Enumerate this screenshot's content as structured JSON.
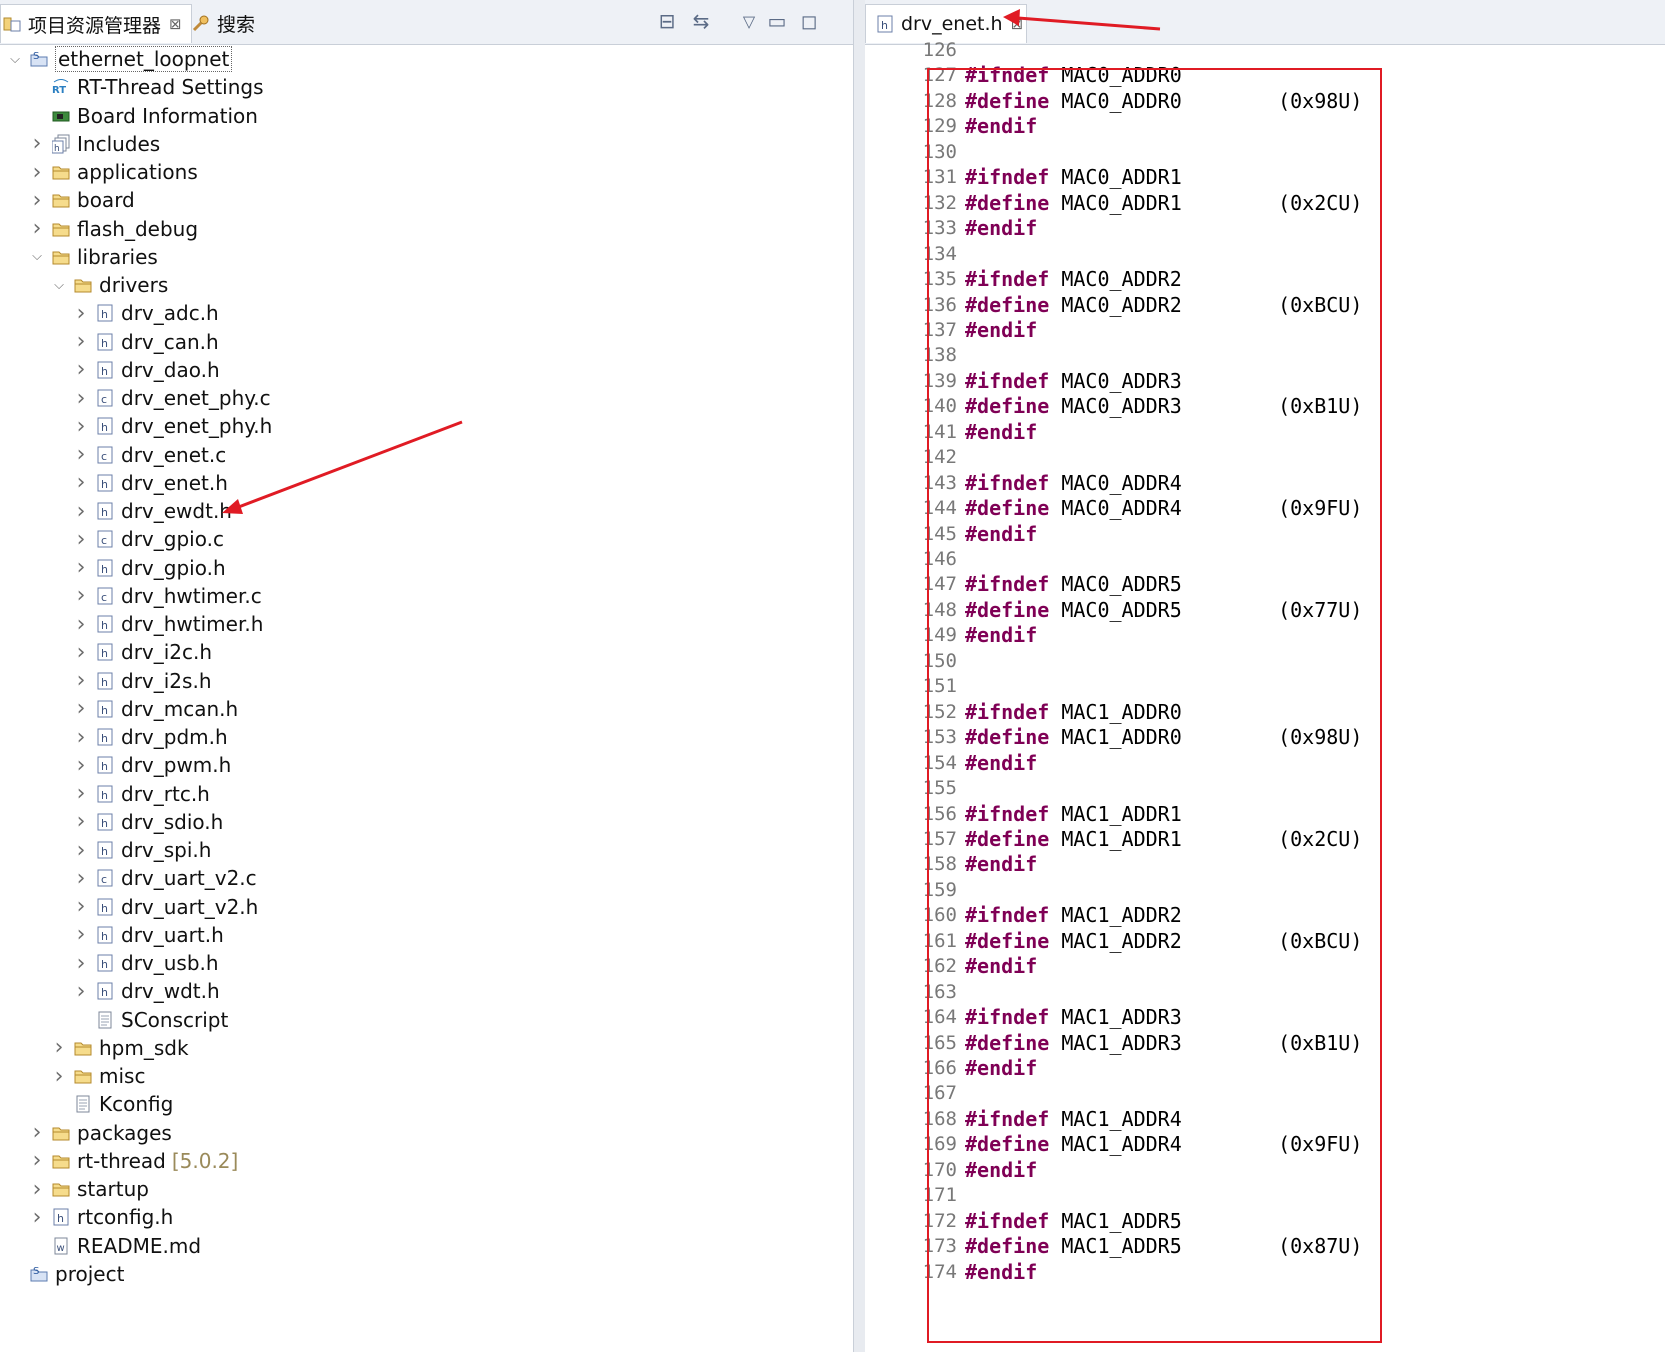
{
  "left_panel": {
    "tabs": [
      {
        "label": "项目资源管理器",
        "close": "⊠",
        "icon": "project-explorer-icon"
      },
      {
        "label": "搜索",
        "icon": "search-icon"
      }
    ],
    "toolbar": [
      "collapse-all-icon",
      "link-with-editor-icon",
      "view-menu-icon",
      "minimize-icon",
      "maximize-icon"
    ],
    "tree": [
      {
        "label": "ethernet_loopnet",
        "depth": 0,
        "expand": "open",
        "icon": "project-icon",
        "selected": true
      },
      {
        "label": "RT-Thread Settings",
        "depth": 1,
        "expand": "none",
        "icon": "rt-settings-icon"
      },
      {
        "label": "Board Information",
        "depth": 1,
        "expand": "none",
        "icon": "board-icon"
      },
      {
        "label": "Includes",
        "depth": 1,
        "expand": "closed",
        "icon": "includes-icon"
      },
      {
        "label": "applications",
        "depth": 1,
        "expand": "closed",
        "icon": "folder-icon"
      },
      {
        "label": "board",
        "depth": 1,
        "expand": "closed",
        "icon": "folder-icon"
      },
      {
        "label": "flash_debug",
        "depth": 1,
        "expand": "closed",
        "icon": "folder-icon"
      },
      {
        "label": "libraries",
        "depth": 1,
        "expand": "open",
        "icon": "folder-icon"
      },
      {
        "label": "drivers",
        "depth": 2,
        "expand": "open",
        "icon": "folder-icon"
      },
      {
        "label": "drv_adc.h",
        "depth": 3,
        "expand": "closed",
        "icon": "h-file-icon"
      },
      {
        "label": "drv_can.h",
        "depth": 3,
        "expand": "closed",
        "icon": "h-file-icon"
      },
      {
        "label": "drv_dao.h",
        "depth": 3,
        "expand": "closed",
        "icon": "h-file-icon"
      },
      {
        "label": "drv_enet_phy.c",
        "depth": 3,
        "expand": "closed",
        "icon": "c-file-icon"
      },
      {
        "label": "drv_enet_phy.h",
        "depth": 3,
        "expand": "closed",
        "icon": "h-file-icon"
      },
      {
        "label": "drv_enet.c",
        "depth": 3,
        "expand": "closed",
        "icon": "c-file-icon"
      },
      {
        "label": "drv_enet.h",
        "depth": 3,
        "expand": "closed",
        "icon": "h-file-icon"
      },
      {
        "label": "drv_ewdt.h",
        "depth": 3,
        "expand": "closed",
        "icon": "h-file-icon"
      },
      {
        "label": "drv_gpio.c",
        "depth": 3,
        "expand": "closed",
        "icon": "c-file-icon"
      },
      {
        "label": "drv_gpio.h",
        "depth": 3,
        "expand": "closed",
        "icon": "h-file-icon"
      },
      {
        "label": "drv_hwtimer.c",
        "depth": 3,
        "expand": "closed",
        "icon": "c-file-icon"
      },
      {
        "label": "drv_hwtimer.h",
        "depth": 3,
        "expand": "closed",
        "icon": "h-file-icon"
      },
      {
        "label": "drv_i2c.h",
        "depth": 3,
        "expand": "closed",
        "icon": "h-file-icon"
      },
      {
        "label": "drv_i2s.h",
        "depth": 3,
        "expand": "closed",
        "icon": "h-file-icon"
      },
      {
        "label": "drv_mcan.h",
        "depth": 3,
        "expand": "closed",
        "icon": "h-file-icon"
      },
      {
        "label": "drv_pdm.h",
        "depth": 3,
        "expand": "closed",
        "icon": "h-file-icon"
      },
      {
        "label": "drv_pwm.h",
        "depth": 3,
        "expand": "closed",
        "icon": "h-file-icon"
      },
      {
        "label": "drv_rtc.h",
        "depth": 3,
        "expand": "closed",
        "icon": "h-file-icon"
      },
      {
        "label": "drv_sdio.h",
        "depth": 3,
        "expand": "closed",
        "icon": "h-file-icon"
      },
      {
        "label": "drv_spi.h",
        "depth": 3,
        "expand": "closed",
        "icon": "h-file-icon"
      },
      {
        "label": "drv_uart_v2.c",
        "depth": 3,
        "expand": "closed",
        "icon": "c-file-icon"
      },
      {
        "label": "drv_uart_v2.h",
        "depth": 3,
        "expand": "closed",
        "icon": "h-file-icon"
      },
      {
        "label": "drv_uart.h",
        "depth": 3,
        "expand": "closed",
        "icon": "h-file-icon"
      },
      {
        "label": "drv_usb.h",
        "depth": 3,
        "expand": "closed",
        "icon": "h-file-icon"
      },
      {
        "label": "drv_wdt.h",
        "depth": 3,
        "expand": "closed",
        "icon": "h-file-icon"
      },
      {
        "label": "SConscript",
        "depth": 3,
        "expand": "none",
        "icon": "text-file-icon"
      },
      {
        "label": "hpm_sdk",
        "depth": 2,
        "expand": "closed",
        "icon": "folder-icon"
      },
      {
        "label": "misc",
        "depth": 2,
        "expand": "closed",
        "icon": "folder-icon"
      },
      {
        "label": "Kconfig",
        "depth": 2,
        "expand": "none",
        "icon": "text-file-icon"
      },
      {
        "label": "packages",
        "depth": 1,
        "expand": "closed",
        "icon": "folder-icon"
      },
      {
        "label": "rt-thread",
        "depth": 1,
        "expand": "closed",
        "icon": "folder-icon",
        "suffix": "[5.0.2]"
      },
      {
        "label": "startup",
        "depth": 1,
        "expand": "closed",
        "icon": "folder-icon"
      },
      {
        "label": "rtconfig.h",
        "depth": 1,
        "expand": "closed",
        "icon": "h-file-icon"
      },
      {
        "label": "README.md",
        "depth": 1,
        "expand": "none",
        "icon": "md-file-icon"
      },
      {
        "label": "project",
        "depth": 0,
        "expand": "none",
        "icon": "project-icon"
      }
    ]
  },
  "editor": {
    "tab": {
      "label": "drv_enet.h",
      "close": "⊠",
      "icon": "h-file-icon"
    },
    "lines": [
      {
        "num": "126",
        "kw": "",
        "text": ""
      },
      {
        "num": "127",
        "kw": "#ifndef",
        "text": " MAC0_ADDR0"
      },
      {
        "num": "128",
        "kw": "#define",
        "text": " MAC0_ADDR0        (0x98U)"
      },
      {
        "num": "129",
        "kw": "#endif",
        "text": ""
      },
      {
        "num": "130",
        "kw": "",
        "text": ""
      },
      {
        "num": "131",
        "kw": "#ifndef",
        "text": " MAC0_ADDR1"
      },
      {
        "num": "132",
        "kw": "#define",
        "text": " MAC0_ADDR1        (0x2CU)"
      },
      {
        "num": "133",
        "kw": "#endif",
        "text": ""
      },
      {
        "num": "134",
        "kw": "",
        "text": ""
      },
      {
        "num": "135",
        "kw": "#ifndef",
        "text": " MAC0_ADDR2"
      },
      {
        "num": "136",
        "kw": "#define",
        "text": " MAC0_ADDR2        (0xBCU)"
      },
      {
        "num": "137",
        "kw": "#endif",
        "text": ""
      },
      {
        "num": "138",
        "kw": "",
        "text": ""
      },
      {
        "num": "139",
        "kw": "#ifndef",
        "text": " MAC0_ADDR3"
      },
      {
        "num": "140",
        "kw": "#define",
        "text": " MAC0_ADDR3        (0xB1U)"
      },
      {
        "num": "141",
        "kw": "#endif",
        "text": ""
      },
      {
        "num": "142",
        "kw": "",
        "text": ""
      },
      {
        "num": "143",
        "kw": "#ifndef",
        "text": " MAC0_ADDR4"
      },
      {
        "num": "144",
        "kw": "#define",
        "text": " MAC0_ADDR4        (0x9FU)"
      },
      {
        "num": "145",
        "kw": "#endif",
        "text": ""
      },
      {
        "num": "146",
        "kw": "",
        "text": ""
      },
      {
        "num": "147",
        "kw": "#ifndef",
        "text": " MAC0_ADDR5"
      },
      {
        "num": "148",
        "kw": "#define",
        "text": " MAC0_ADDR5        (0x77U)"
      },
      {
        "num": "149",
        "kw": "#endif",
        "text": ""
      },
      {
        "num": "150",
        "kw": "",
        "text": ""
      },
      {
        "num": "151",
        "kw": "",
        "text": ""
      },
      {
        "num": "152",
        "kw": "#ifndef",
        "text": " MAC1_ADDR0"
      },
      {
        "num": "153",
        "kw": "#define",
        "text": " MAC1_ADDR0        (0x98U)"
      },
      {
        "num": "154",
        "kw": "#endif",
        "text": ""
      },
      {
        "num": "155",
        "kw": "",
        "text": ""
      },
      {
        "num": "156",
        "kw": "#ifndef",
        "text": " MAC1_ADDR1"
      },
      {
        "num": "157",
        "kw": "#define",
        "text": " MAC1_ADDR1        (0x2CU)"
      },
      {
        "num": "158",
        "kw": "#endif",
        "text": ""
      },
      {
        "num": "159",
        "kw": "",
        "text": ""
      },
      {
        "num": "160",
        "kw": "#ifndef",
        "text": " MAC1_ADDR2"
      },
      {
        "num": "161",
        "kw": "#define",
        "text": " MAC1_ADDR2        (0xBCU)"
      },
      {
        "num": "162",
        "kw": "#endif",
        "text": ""
      },
      {
        "num": "163",
        "kw": "",
        "text": ""
      },
      {
        "num": "164",
        "kw": "#ifndef",
        "text": " MAC1_ADDR3"
      },
      {
        "num": "165",
        "kw": "#define",
        "text": " MAC1_ADDR3        (0xB1U)"
      },
      {
        "num": "166",
        "kw": "#endif",
        "text": ""
      },
      {
        "num": "167",
        "kw": "",
        "text": ""
      },
      {
        "num": "168",
        "kw": "#ifndef",
        "text": " MAC1_ADDR4"
      },
      {
        "num": "169",
        "kw": "#define",
        "text": " MAC1_ADDR4        (0x9FU)"
      },
      {
        "num": "170",
        "kw": "#endif",
        "text": ""
      },
      {
        "num": "171",
        "kw": "",
        "text": ""
      },
      {
        "num": "172",
        "kw": "#ifndef",
        "text": " MAC1_ADDR5"
      },
      {
        "num": "173",
        "kw": "#define",
        "text": " MAC1_ADDR5        (0x87U)"
      },
      {
        "num": "174",
        "kw": "#endif",
        "text": ""
      }
    ]
  },
  "colors": {
    "keyword": "#7f0055",
    "annotation_red": "#e01b24",
    "line_number": "#787878",
    "tab_bar_bg": "#eef1f6"
  }
}
